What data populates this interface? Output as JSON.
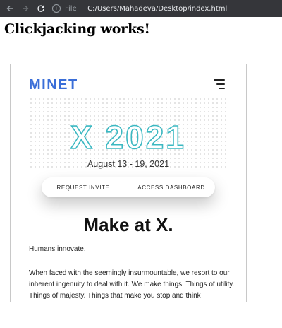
{
  "browser": {
    "scheme_label": "File",
    "path": "C:/Users/Mahadeva/Desktop/index.html"
  },
  "page": {
    "heading": "Clickjacking works!"
  },
  "iframe": {
    "logo": "MINET",
    "hero_title": "X 2021",
    "date": "August 13 - 19, 2021",
    "request_invite": "REQUEST INVITE",
    "access_dashboard": "ACCESS DASHBOARD",
    "section_title": "Make at X.",
    "paragraph1": "Humans innovate.",
    "paragraph2": "When faced with the seemingly insurmountable, we resort to our inherent ingenuity to deal with it. We make things. Things of utility. Things of majesty. Things that make you stop and think"
  },
  "colors": {
    "chrome_bg": "#35363a",
    "logo": "#3a6ed8",
    "hero_outline": "#3bb8c2"
  },
  "icons": [
    "back-arrow-icon",
    "forward-arrow-icon",
    "reload-icon",
    "info-icon",
    "hamburger-menu-icon"
  ]
}
